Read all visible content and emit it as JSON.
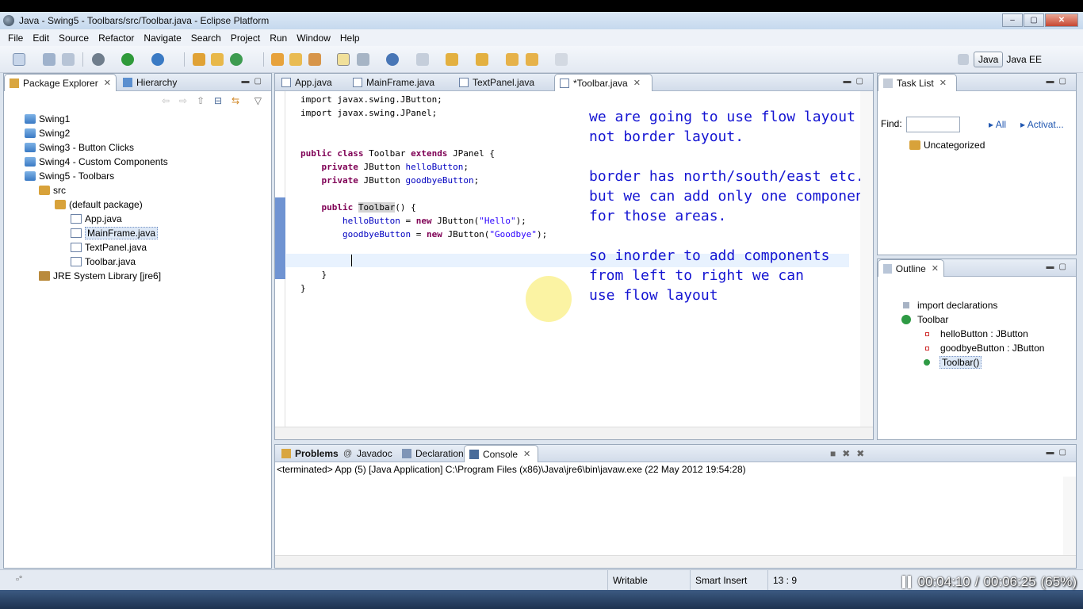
{
  "window": {
    "title": "Java - Swing5 - Toolbars/src/Toolbar.java - Eclipse Platform",
    "min": "–",
    "max": "▢",
    "close": "✕"
  },
  "menu": [
    "File",
    "Edit",
    "Source",
    "Refactor",
    "Navigate",
    "Search",
    "Project",
    "Run",
    "Window",
    "Help"
  ],
  "perspectives": {
    "java": "Java",
    "javaee": "Java EE"
  },
  "package_explorer": {
    "tabs": [
      "Package Explorer",
      "Hierarchy"
    ],
    "items": [
      "Swing1",
      "Swing2",
      "Swing3 - Button Clicks",
      "Swing4 - Custom Components",
      "Swing5 - Toolbars",
      "src",
      "(default package)",
      "App.java",
      "MainFrame.java",
      "TextPanel.java",
      "Toolbar.java",
      "JRE System Library [jre6]"
    ]
  },
  "editor": {
    "tabs": [
      "App.java",
      "MainFrame.java",
      "TextPanel.java",
      "*Toolbar.java"
    ],
    "code": {
      "l1": "import javax.swing.JButton;",
      "l2": "import javax.swing.JPanel;",
      "l4a": "public class ",
      "l4b": "Toolbar",
      "l4c": " extends ",
      "l4d": "JPanel {",
      "l5a": "    private ",
      "l5b": "JButton ",
      "l5c": "helloButton",
      "l5d": ";",
      "l6a": "    private ",
      "l6b": "JButton ",
      "l6c": "goodbyeButton",
      "l6d": ";",
      "l8a": "    public ",
      "l8b": "Toolbar",
      "l8c": "() {",
      "l9a": "        ",
      "l9b": "helloButton",
      "l9c": " = ",
      "l9d": "new",
      "l9e": " JButton(",
      "l9f": "\"Hello\"",
      "l9g": ");",
      "l10a": "        ",
      "l10b": "goodbyeButton",
      "l10c": " = ",
      "l10d": "new",
      "l10e": " JButton(",
      "l10f": "\"Goodbye\"",
      "l10g": ");",
      "l13": "    }",
      "l14": "}"
    },
    "annotation": "we are going to use flow layout\nnot border layout.\n\nborder has north/south/east etc..\nbut we can add only one component\nfor those areas.\n\nso inorder to add components\nfrom left to right we can\nuse flow layout"
  },
  "tasklist": {
    "tab": "Task List",
    "find_label": "Find:",
    "find_value": "",
    "all": "All",
    "activate": "Activat...",
    "category": "Uncategorized"
  },
  "outline": {
    "tab": "Outline",
    "items": [
      "import declarations",
      "Toolbar",
      "helloButton : JButton",
      "goodbyeButton : JButton",
      "Toolbar()"
    ]
  },
  "bottom": {
    "tabs": [
      "Problems",
      "Javadoc",
      "Declaration",
      "Console"
    ],
    "console_header": "<terminated> App (5) [Java Application] C:\\Program Files (x86)\\Java\\jre6\\bin\\javaw.exe (22 May 2012 19:54:28)"
  },
  "status": {
    "writable": "Writable",
    "insert": "Smart Insert",
    "position": "13 : 9"
  },
  "player": {
    "current": "00:04:10",
    "sep": "/",
    "total": "00:06:25",
    "speed": "(65%)"
  },
  "colors": {
    "keyword": "#7f0055",
    "field": "#0000c0",
    "string": "#2a00ff",
    "annotation": "#1414d2"
  }
}
